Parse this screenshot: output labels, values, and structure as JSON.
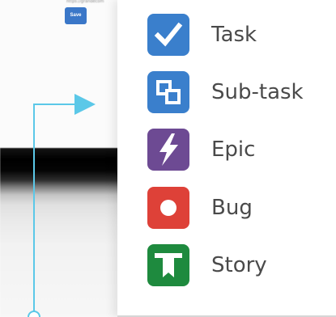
{
  "background": {
    "url_text": "https://grandecom",
    "save_label": "Save"
  },
  "menu": {
    "items": [
      {
        "label": "Task",
        "icon": "task-checkmark-icon",
        "color": "#3a7fcc"
      },
      {
        "label": "Sub-task",
        "icon": "subtask-icon",
        "color": "#3a7fcc"
      },
      {
        "label": "Epic",
        "icon": "epic-lightning-icon",
        "color": "#6d4a93"
      },
      {
        "label": "Bug",
        "icon": "bug-dot-icon",
        "color": "#de4138"
      },
      {
        "label": "Story",
        "icon": "story-bookmark-icon",
        "color": "#1e8a3e"
      }
    ]
  },
  "colors": {
    "connector": "#5bc8e8"
  }
}
